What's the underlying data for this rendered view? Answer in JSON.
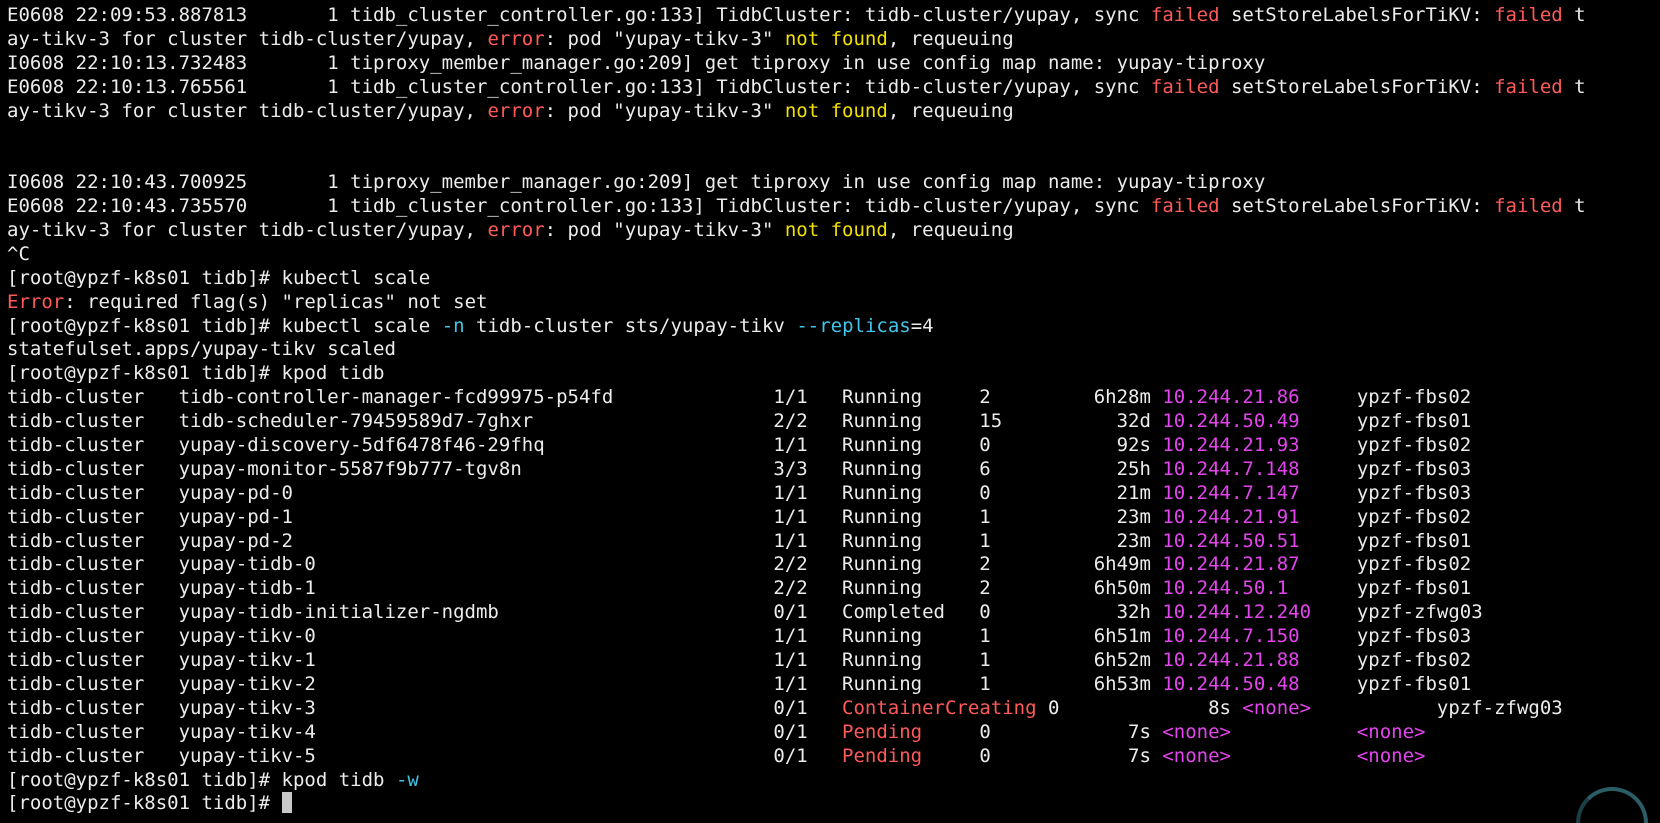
{
  "terminal": {
    "lines": [
      [
        {
          "t": "E0608 22:09:53.887813       1 tidb_cluster_controller.go:133] TidbCluster: tidb-cluster/yupay, sync "
        },
        {
          "t": "failed",
          "c": "red"
        },
        {
          "t": " setStoreLabelsForTiKV: "
        },
        {
          "t": "failed",
          "c": "red"
        },
        {
          "t": " t"
        }
      ],
      [
        {
          "t": "ay-tikv-3 for cluster tidb-cluster/yupay, "
        },
        {
          "t": "error",
          "c": "red"
        },
        {
          "t": ": pod \"yupay-tikv-3\" "
        },
        {
          "t": "not found",
          "c": "yellow"
        },
        {
          "t": ", requeuing"
        }
      ],
      [
        {
          "t": "I0608 22:10:13.732483       1 tiproxy_member_manager.go:209] get tiproxy in use config map name: yupay-tiproxy"
        }
      ],
      [
        {
          "t": "E0608 22:10:13.765561       1 tidb_cluster_controller.go:133] TidbCluster: tidb-cluster/yupay, sync "
        },
        {
          "t": "failed",
          "c": "red"
        },
        {
          "t": " setStoreLabelsForTiKV: "
        },
        {
          "t": "failed",
          "c": "red"
        },
        {
          "t": " t"
        }
      ],
      [
        {
          "t": "ay-tikv-3 for cluster tidb-cluster/yupay, "
        },
        {
          "t": "error",
          "c": "red"
        },
        {
          "t": ": pod \"yupay-tikv-3\" "
        },
        {
          "t": "not found",
          "c": "yellow"
        },
        {
          "t": ", requeuing"
        }
      ],
      [],
      [],
      [
        {
          "t": "I0608 22:10:43.700925       1 tiproxy_member_manager.go:209] get tiproxy in use config map name: yupay-tiproxy"
        }
      ],
      [
        {
          "t": "E0608 22:10:43.735570       1 tidb_cluster_controller.go:133] TidbCluster: tidb-cluster/yupay, sync "
        },
        {
          "t": "failed",
          "c": "red"
        },
        {
          "t": " setStoreLabelsForTiKV: "
        },
        {
          "t": "failed",
          "c": "red"
        },
        {
          "t": " t"
        }
      ],
      [
        {
          "t": "ay-tikv-3 for cluster tidb-cluster/yupay, "
        },
        {
          "t": "error",
          "c": "red"
        },
        {
          "t": ": pod \"yupay-tikv-3\" "
        },
        {
          "t": "not found",
          "c": "yellow"
        },
        {
          "t": ", requeuing"
        }
      ],
      [
        {
          "t": "^C"
        }
      ],
      [
        {
          "t": "[root@ypzf-k8s01 tidb]# kubectl scale"
        }
      ],
      [
        {
          "t": "Error",
          "c": "red"
        },
        {
          "t": ": required flag(s) \"replicas\" not set"
        }
      ],
      [
        {
          "t": "[root@ypzf-k8s01 tidb]# kubectl scale "
        },
        {
          "t": "-n",
          "c": "cyan"
        },
        {
          "t": " tidb-cluster sts/yupay-tikv "
        },
        {
          "t": "--replicas",
          "c": "cyan"
        },
        {
          "t": "=4"
        }
      ],
      [
        {
          "t": "statefulset.apps/yupay-tikv scaled"
        }
      ],
      [
        {
          "t": "[root@ypzf-k8s01 tidb]# kpod tidb"
        }
      ],
      [
        {
          "t": "tidb-cluster   tidb-controller-manager-fcd99975-p54fd              1/1   Running     2         6h28m "
        },
        {
          "t": "10.244.21.86",
          "c": "magenta"
        },
        {
          "t": "     ypzf-fbs02"
        }
      ],
      [
        {
          "t": "tidb-cluster   tidb-scheduler-79459589d7-7ghxr                     2/2   Running     15          32d "
        },
        {
          "t": "10.244.50.49",
          "c": "magenta"
        },
        {
          "t": "     ypzf-fbs01"
        }
      ],
      [
        {
          "t": "tidb-cluster   yupay-discovery-5df6478f46-29fhq                    1/1   Running     0           92s "
        },
        {
          "t": "10.244.21.93",
          "c": "magenta"
        },
        {
          "t": "     ypzf-fbs02"
        }
      ],
      [
        {
          "t": "tidb-cluster   yupay-monitor-5587f9b777-tgv8n                      3/3   Running     6           25h "
        },
        {
          "t": "10.244.7.148",
          "c": "magenta"
        },
        {
          "t": "     ypzf-fbs03"
        }
      ],
      [
        {
          "t": "tidb-cluster   yupay-pd-0                                          1/1   Running     0           21m "
        },
        {
          "t": "10.244.7.147",
          "c": "magenta"
        },
        {
          "t": "     ypzf-fbs03"
        }
      ],
      [
        {
          "t": "tidb-cluster   yupay-pd-1                                          1/1   Running     1           23m "
        },
        {
          "t": "10.244.21.91",
          "c": "magenta"
        },
        {
          "t": "     ypzf-fbs02"
        }
      ],
      [
        {
          "t": "tidb-cluster   yupay-pd-2                                          1/1   Running     1           23m "
        },
        {
          "t": "10.244.50.51",
          "c": "magenta"
        },
        {
          "t": "     ypzf-fbs01"
        }
      ],
      [
        {
          "t": "tidb-cluster   yupay-tidb-0                                        2/2   Running     2         6h49m "
        },
        {
          "t": "10.244.21.87",
          "c": "magenta"
        },
        {
          "t": "     ypzf-fbs02"
        }
      ],
      [
        {
          "t": "tidb-cluster   yupay-tidb-1                                        2/2   Running     2         6h50m "
        },
        {
          "t": "10.244.50.1",
          "c": "magenta"
        },
        {
          "t": "      ypzf-fbs01"
        }
      ],
      [
        {
          "t": "tidb-cluster   yupay-tidb-initializer-ngdmb                        0/1   Completed   0           32h "
        },
        {
          "t": "10.244.12.240",
          "c": "magenta"
        },
        {
          "t": "    ypzf-zfwg03"
        }
      ],
      [
        {
          "t": "tidb-cluster   yupay-tikv-0                                        1/1   Running     1         6h51m "
        },
        {
          "t": "10.244.7.150",
          "c": "magenta"
        },
        {
          "t": "     ypzf-fbs03"
        }
      ],
      [
        {
          "t": "tidb-cluster   yupay-tikv-1                                        1/1   Running     1         6h52m "
        },
        {
          "t": "10.244.21.88",
          "c": "magenta"
        },
        {
          "t": "     ypzf-fbs02"
        }
      ],
      [
        {
          "t": "tidb-cluster   yupay-tikv-2                                        1/1   Running     1         6h53m "
        },
        {
          "t": "10.244.50.48",
          "c": "magenta"
        },
        {
          "t": "     ypzf-fbs01"
        }
      ],
      [
        {
          "t": "tidb-cluster   yupay-tikv-3                                        0/1   "
        },
        {
          "t": "ContainerCreating",
          "c": "red"
        },
        {
          "t": " 0             8s "
        },
        {
          "t": "<none>",
          "c": "magenta"
        },
        {
          "t": "           ypzf-zfwg03"
        }
      ],
      [
        {
          "t": "tidb-cluster   yupay-tikv-4                                        0/1   "
        },
        {
          "t": "Pending",
          "c": "red"
        },
        {
          "t": "     0            7s "
        },
        {
          "t": "<none>",
          "c": "magenta"
        },
        {
          "t": "           "
        },
        {
          "t": "<none>",
          "c": "magenta"
        }
      ],
      [
        {
          "t": "tidb-cluster   yupay-tikv-5                                        0/1   "
        },
        {
          "t": "Pending",
          "c": "red"
        },
        {
          "t": "     0            7s "
        },
        {
          "t": "<none>",
          "c": "magenta"
        },
        {
          "t": "           "
        },
        {
          "t": "<none>",
          "c": "magenta"
        }
      ],
      [
        {
          "t": "[root@ypzf-k8s01 tidb]# kpod tidb "
        },
        {
          "t": "-w",
          "c": "cyan"
        }
      ],
      [
        {
          "t": "[root@ypzf-k8s01 tidb]# "
        }
      ]
    ],
    "colors": {
      "background": "#000000",
      "text": "#ececec",
      "red": "#ff5a5a",
      "yellow": "#f2e100",
      "cyan": "#3fc6e8",
      "magenta": "#e444ee"
    },
    "icons": {
      "cursor": "block-cursor",
      "corner": "circular-progress-icon"
    }
  }
}
